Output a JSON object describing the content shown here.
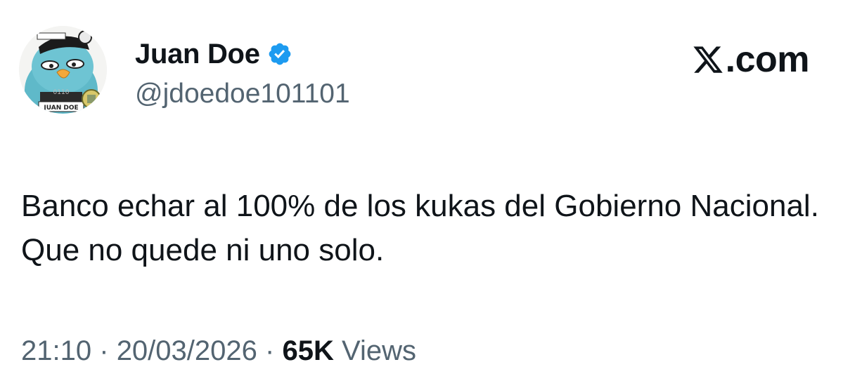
{
  "author": {
    "display_name": "Juan Doe",
    "handle": "@jdoedoe101101",
    "verified": true,
    "avatar_caption": "JUAN DOE",
    "avatar_sign_number": "0110",
    "icon": "verified-badge-icon",
    "verified_color": "#1d9bf0"
  },
  "brand": {
    "logo_text": ".com",
    "icon": "x-logo-icon"
  },
  "tweet": {
    "text": "Banco echar al 100% de los kukas del Gobierno Nacional. Que no quede ni uno solo."
  },
  "meta": {
    "time": "21:10",
    "separator": "·",
    "date": "20/03/2026",
    "views_count": "65K",
    "views_label": "Views"
  },
  "colors": {
    "text_primary": "#0f1419",
    "text_secondary": "#536471",
    "background": "#ffffff"
  }
}
